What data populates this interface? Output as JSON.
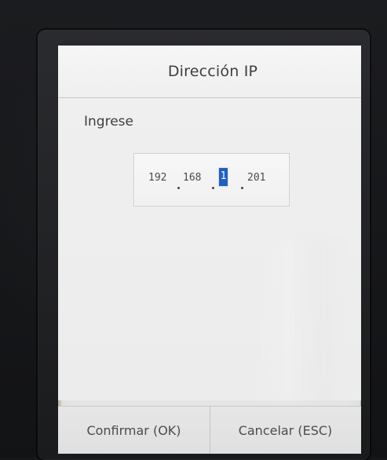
{
  "dialog": {
    "title": "Dirección IP",
    "prompt": "Ingrese"
  },
  "ip_address": {
    "octets": [
      "192",
      "168",
      "1",
      "201"
    ],
    "selected_octet_index": 2
  },
  "actions": {
    "confirm_label": "Confirmar (OK)",
    "cancel_label": "Cancelar (ESC)"
  },
  "colors": {
    "selection": "#1f60c7",
    "screen_background": "#ececec",
    "text": "#444444"
  }
}
